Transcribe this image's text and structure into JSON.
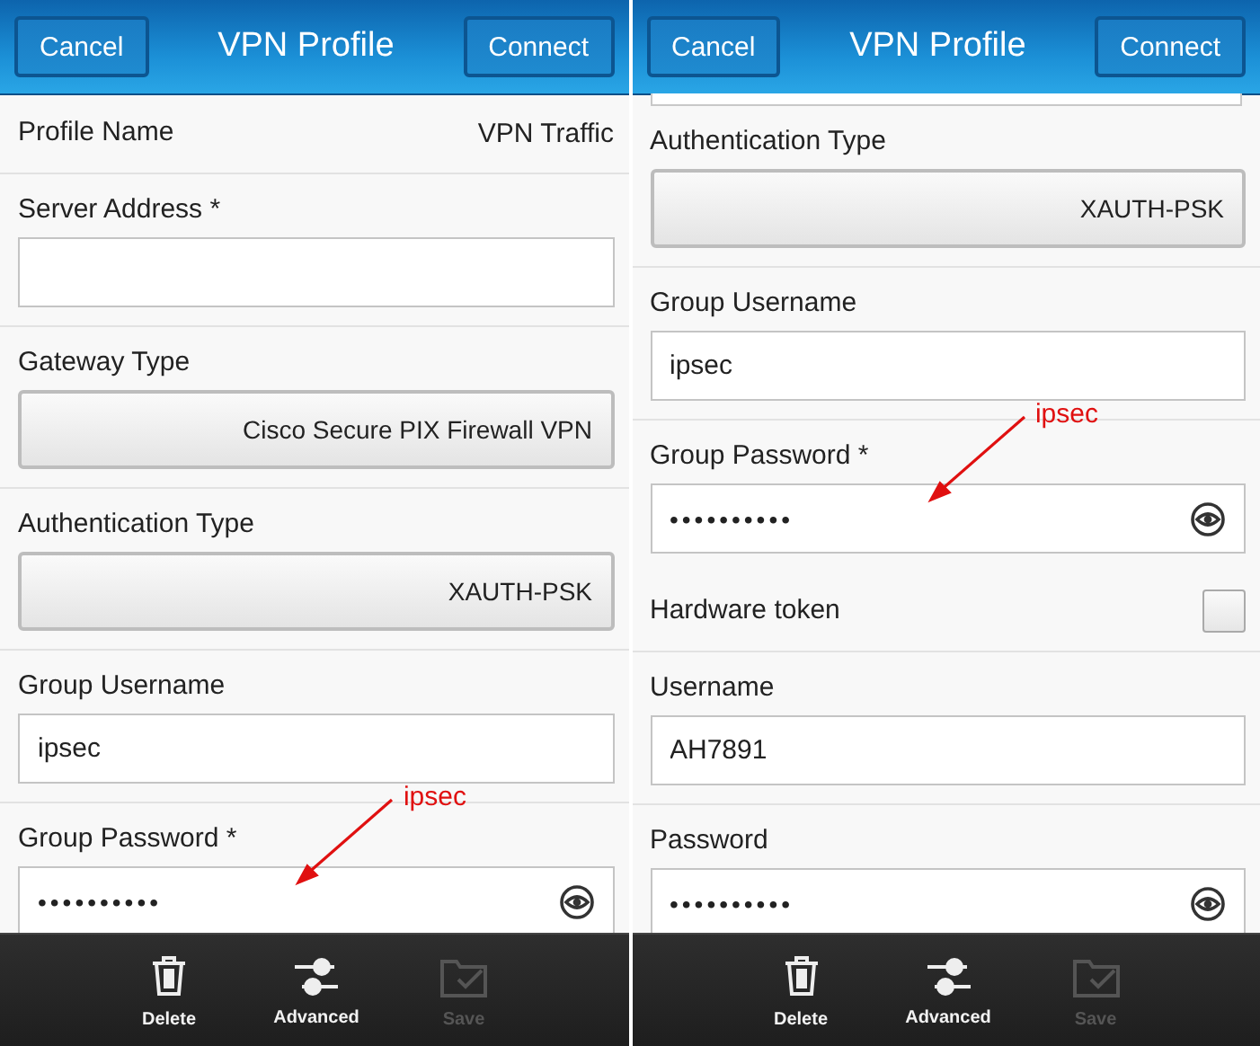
{
  "screens": [
    {
      "header": {
        "cancel": "Cancel",
        "title": "VPN Profile",
        "connect": "Connect"
      },
      "partial_top": false,
      "fields": [
        {
          "kind": "row",
          "label": "Profile Name",
          "value": "VPN Traffic"
        },
        {
          "kind": "text",
          "label": "Server Address *"
        },
        {
          "kind": "dropdown",
          "label": "Gateway Type",
          "value": "Cisco Secure PIX Firewall VPN"
        },
        {
          "kind": "dropdown",
          "label": "Authentication Type",
          "value": "XAUTH-PSK"
        },
        {
          "kind": "text",
          "label": "Group Username",
          "value": "ipsec"
        },
        {
          "kind": "password",
          "label": "Group Password *",
          "value": "••••••••••",
          "annotation": "ipsec"
        }
      ],
      "toolbar": [
        {
          "kind": "delete",
          "label": "Delete",
          "disabled": false
        },
        {
          "kind": "advanced",
          "label": "Advanced",
          "disabled": false
        },
        {
          "kind": "save",
          "label": "Save",
          "disabled": true
        }
      ]
    },
    {
      "header": {
        "cancel": "Cancel",
        "title": "VPN Profile",
        "connect": "Connect"
      },
      "partial_top": true,
      "fields": [
        {
          "kind": "dropdown",
          "label": "Authentication Type",
          "value": "XAUTH-PSK"
        },
        {
          "kind": "text",
          "label": "Group Username",
          "value": "ipsec"
        },
        {
          "kind": "password",
          "label": "Group Password *",
          "value": "••••••••••",
          "annotation": "ipsec"
        },
        {
          "kind": "checkbox",
          "label": "Hardware token",
          "checked": false
        },
        {
          "kind": "text",
          "label": "Username",
          "value": "AH7891"
        },
        {
          "kind": "password",
          "label": "Password",
          "value": "••••••••••"
        }
      ],
      "toolbar": [
        {
          "kind": "delete",
          "label": "Delete",
          "disabled": false
        },
        {
          "kind": "advanced",
          "label": "Advanced",
          "disabled": false
        },
        {
          "kind": "save",
          "label": "Save",
          "disabled": true
        }
      ]
    }
  ]
}
